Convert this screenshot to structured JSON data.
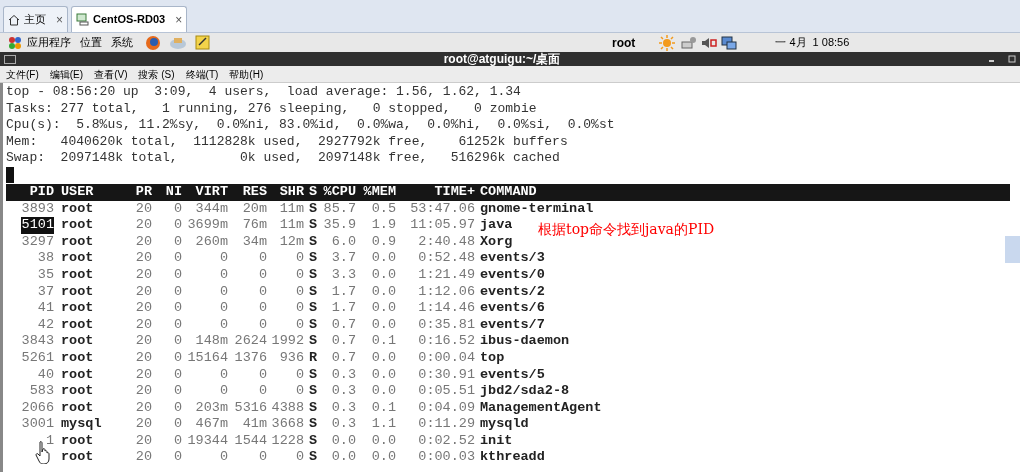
{
  "browser_tabs": [
    {
      "label": "主页",
      "selected": false,
      "close": "×"
    },
    {
      "label": "CentOS-RD03",
      "selected": true,
      "close": "×"
    }
  ],
  "panel": {
    "menus": [
      "应用程序",
      "位置",
      "系统"
    ],
    "user": "root",
    "clock": "一 4月  1 08:56"
  },
  "terminal": {
    "title": "root@atguigu:~/桌面",
    "menu": [
      "文件(F)",
      "编辑(E)",
      "查看(V)",
      "搜索 (S)",
      "终端(T)",
      "帮助(H)"
    ],
    "summary": [
      "top - 08:56:20 up  3:09,  4 users,  load average: 1.56, 1.62, 1.34",
      "Tasks: 277 total,   1 running, 276 sleeping,   0 stopped,   0 zombie",
      "Cpu(s):  5.8%us, 11.2%sy,  0.0%ni, 83.0%id,  0.0%wa,  0.0%hi,  0.0%si,  0.0%st",
      "Mem:   4040620k total,  1112828k used,  2927792k free,    61252k buffers",
      "Swap:  2097148k total,        0k used,  2097148k free,   516296k cached"
    ],
    "columns": [
      "PID",
      "USER",
      "PR",
      "NI",
      "VIRT",
      "RES",
      "SHR",
      "S",
      "%CPU",
      "%MEM",
      "TIME+",
      "COMMAND"
    ],
    "rows": [
      {
        "pid": "3893",
        "user": "root",
        "pr": "20",
        "ni": "0",
        "virt": "344m",
        "res": "20m",
        "shr": "11m",
        "s": "S",
        "cpu": "85.7",
        "mem": "0.5",
        "time": "53:47.06",
        "command": "gnome-terminal",
        "highlighted": false
      },
      {
        "pid": "5101",
        "user": "root",
        "pr": "20",
        "ni": "0",
        "virt": "3699m",
        "res": "76m",
        "shr": "11m",
        "s": "S",
        "cpu": "35.9",
        "mem": "1.9",
        "time": "11:05.97",
        "command": "java",
        "highlighted": true
      },
      {
        "pid": "3297",
        "user": "root",
        "pr": "20",
        "ni": "0",
        "virt": "260m",
        "res": "34m",
        "shr": "12m",
        "s": "S",
        "cpu": "6.0",
        "mem": "0.9",
        "time": "2:40.48",
        "command": "Xorg",
        "highlighted": false
      },
      {
        "pid": "38",
        "user": "root",
        "pr": "20",
        "ni": "0",
        "virt": "0",
        "res": "0",
        "shr": "0",
        "s": "S",
        "cpu": "3.7",
        "mem": "0.0",
        "time": "0:52.48",
        "command": "events/3",
        "highlighted": false
      },
      {
        "pid": "35",
        "user": "root",
        "pr": "20",
        "ni": "0",
        "virt": "0",
        "res": "0",
        "shr": "0",
        "s": "S",
        "cpu": "3.3",
        "mem": "0.0",
        "time": "1:21.49",
        "command": "events/0",
        "highlighted": false
      },
      {
        "pid": "37",
        "user": "root",
        "pr": "20",
        "ni": "0",
        "virt": "0",
        "res": "0",
        "shr": "0",
        "s": "S",
        "cpu": "1.7",
        "mem": "0.0",
        "time": "1:12.06",
        "command": "events/2",
        "highlighted": false
      },
      {
        "pid": "41",
        "user": "root",
        "pr": "20",
        "ni": "0",
        "virt": "0",
        "res": "0",
        "shr": "0",
        "s": "S",
        "cpu": "1.7",
        "mem": "0.0",
        "time": "1:14.46",
        "command": "events/6",
        "highlighted": false
      },
      {
        "pid": "42",
        "user": "root",
        "pr": "20",
        "ni": "0",
        "virt": "0",
        "res": "0",
        "shr": "0",
        "s": "S",
        "cpu": "0.7",
        "mem": "0.0",
        "time": "0:35.81",
        "command": "events/7",
        "highlighted": false
      },
      {
        "pid": "3843",
        "user": "root",
        "pr": "20",
        "ni": "0",
        "virt": "148m",
        "res": "2624",
        "shr": "1992",
        "s": "S",
        "cpu": "0.7",
        "mem": "0.1",
        "time": "0:16.52",
        "command": "ibus-daemon",
        "highlighted": false
      },
      {
        "pid": "5261",
        "user": "root",
        "pr": "20",
        "ni": "0",
        "virt": "15164",
        "res": "1376",
        "shr": "936",
        "s": "R",
        "cpu": "0.7",
        "mem": "0.0",
        "time": "0:00.04",
        "command": "top",
        "highlighted": false
      },
      {
        "pid": "40",
        "user": "root",
        "pr": "20",
        "ni": "0",
        "virt": "0",
        "res": "0",
        "shr": "0",
        "s": "S",
        "cpu": "0.3",
        "mem": "0.0",
        "time": "0:30.91",
        "command": "events/5",
        "highlighted": false
      },
      {
        "pid": "583",
        "user": "root",
        "pr": "20",
        "ni": "0",
        "virt": "0",
        "res": "0",
        "shr": "0",
        "s": "S",
        "cpu": "0.3",
        "mem": "0.0",
        "time": "0:05.51",
        "command": "jbd2/sda2-8",
        "highlighted": false
      },
      {
        "pid": "2066",
        "user": "root",
        "pr": "20",
        "ni": "0",
        "virt": "203m",
        "res": "5316",
        "shr": "4388",
        "s": "S",
        "cpu": "0.3",
        "mem": "0.1",
        "time": "0:04.09",
        "command": "ManagementAgent",
        "highlighted": false
      },
      {
        "pid": "3001",
        "user": "mysql",
        "pr": "20",
        "ni": "0",
        "virt": "467m",
        "res": "41m",
        "shr": "3668",
        "s": "S",
        "cpu": "0.3",
        "mem": "1.1",
        "time": "0:11.29",
        "command": "mysqld",
        "highlighted": false
      },
      {
        "pid": "1",
        "user": "root",
        "pr": "20",
        "ni": "0",
        "virt": "19344",
        "res": "1544",
        "shr": "1228",
        "s": "S",
        "cpu": "0.0",
        "mem": "0.0",
        "time": "0:02.52",
        "command": "init",
        "highlighted": false
      },
      {
        "user": "root",
        "pr": "20",
        "ni": "0",
        "virt": "0",
        "res": "0",
        "shr": "0",
        "s": "S",
        "cpu": "0.0",
        "mem": "0.0",
        "time": "0:00.03",
        "command": "kthreadd",
        "highlighted": false
      }
    ]
  },
  "annotation": "根据top命令找到java的PID"
}
